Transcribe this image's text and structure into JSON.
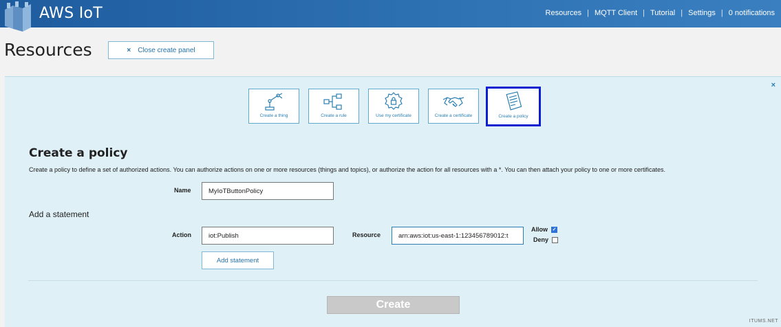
{
  "header": {
    "brand": "AWS IoT",
    "nav": [
      "Resources",
      "MQTT Client",
      "Tutorial",
      "Settings",
      "0 notifications"
    ],
    "accent": "#1e5c9e"
  },
  "page": {
    "title": "Resources",
    "close_panel_label": "Close create panel",
    "close_icon": "×"
  },
  "panel": {
    "close_icon": "×",
    "tiles": [
      {
        "label": "Create a thing",
        "icon": "robot-arm-icon"
      },
      {
        "label": "Create a rule",
        "icon": "flow-icon"
      },
      {
        "label": "Use my certificate",
        "icon": "badge-lock-icon"
      },
      {
        "label": "Create a certificate",
        "icon": "handshake-icon"
      },
      {
        "label": "Create a policy",
        "icon": "document-icon"
      }
    ],
    "selected_tile": 4
  },
  "form": {
    "title": "Create a policy",
    "description": "Create a policy to define a set of authorized actions. You can authorize actions on one or more resources (things and topics), or authorize the action for all resources with a *. You can then attach your policy to one or more certificates.",
    "name_label": "Name",
    "name_value": "MyIoTButtonPolicy",
    "statement_title": "Add a statement",
    "action_label": "Action",
    "action_value": "iot:Publish",
    "resource_label": "Resource",
    "resource_value": "arn:aws:iot:us-east-1:123456789012:t",
    "allow_label": "Allow",
    "allow_checked": true,
    "deny_label": "Deny",
    "deny_checked": false,
    "add_statement_label": "Add statement",
    "create_label": "Create"
  },
  "watermark": "ITUMS.NET"
}
